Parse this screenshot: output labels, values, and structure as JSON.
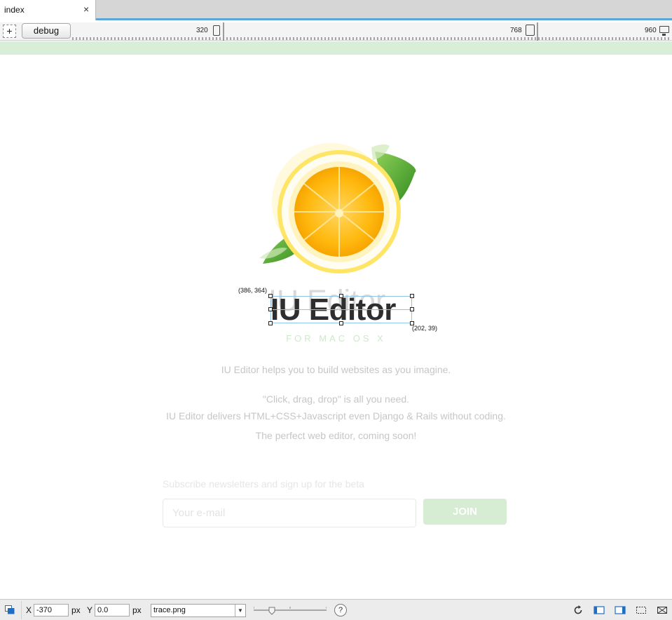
{
  "tab": {
    "title": "index",
    "close": "×"
  },
  "toolbar": {
    "add_label": "+",
    "debug_label": "debug",
    "breakpoints": [
      {
        "label": "320",
        "device": "phone"
      },
      {
        "label": "768",
        "device": "tablet"
      },
      {
        "label": "960",
        "device": "desktop"
      }
    ]
  },
  "canvas": {
    "title_ghost": "IU Editor",
    "title": "IU Editor",
    "selection": {
      "origin_label": "(386, 364)",
      "size_label": "(202, 39)"
    },
    "subtitle": "FOR MAC OS X",
    "description": "IU Editor helps you to build websites as you imagine.",
    "tagline_1": "\"Click, drag, drop\" is all you need.",
    "tagline_2": "IU Editor delivers HTML+CSS+Javascript even Django & Rails without coding.",
    "tagline_3": "The perfect web editor, coming soon!",
    "newsletter_label": "Subscribe newsletters and sign up for the beta",
    "email_placeholder": "Your e-mail",
    "join_label": "JOIN"
  },
  "statusbar": {
    "x_label": "X",
    "x_value": "-370",
    "x_unit": "px",
    "y_label": "Y",
    "y_value": "0.0",
    "y_unit": "px",
    "trace_file": "trace.png",
    "help_label": "?",
    "icons": [
      "layers-icon",
      "refresh-icon",
      "left-panel-icon",
      "right-panel-icon",
      "selection-icon",
      "close-box-icon"
    ]
  },
  "colors": {
    "accent": "#5ba6d8",
    "green_strip": "#d9eed6",
    "join_button": "#d6ecd3",
    "selection": "#8ec5e6"
  }
}
